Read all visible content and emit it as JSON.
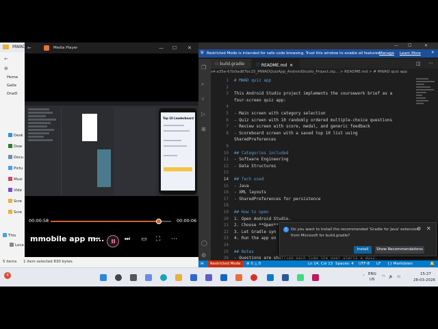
{
  "explorer": {
    "title": "MWAD",
    "nav_items": [
      "Home",
      "Galle",
      "OneD"
    ],
    "side_items": [
      "Desk",
      "Dow",
      "Docu",
      "Pictu",
      "Musi",
      "Vide",
      "Scre",
      "Scre"
    ],
    "this_pc": "This",
    "local": "Loca",
    "status_items": "5 items",
    "status_selected": "1 item selected  830 bytes"
  },
  "player": {
    "title": "Media Player",
    "elapsed": "00:00:58",
    "remaining": "00:00:06",
    "progress": 0.9,
    "name": "mmobile app m...",
    "colors": {
      "accent": "#d06432"
    }
  },
  "phone": {
    "title": "Top 10 Leaderboard"
  },
  "vscode": {
    "restricted_text": "Restricted Mode is intended for safe code browsing. Trust this window to enable all features.",
    "manage": "Manage",
    "learn_more": "Learn More",
    "tabs": [
      "build.gradle",
      "README.md"
    ],
    "breadcrumb": "s4-a35e-67b0ad87bc15_MWADQuizApp_AndroidStudio_Project.zip... > README.md > # MWAD quiz app",
    "lines": [
      {
        "n": "1",
        "t": "# MWAD quiz app",
        "c": "h"
      },
      {
        "n": "2",
        "t": "",
        "c": "k"
      },
      {
        "n": "3",
        "t": "This Android Studio project implements the coursework brief as a",
        "c": "k"
      },
      {
        "n": "",
        "t": "four-screen quiz app:",
        "c": "k"
      },
      {
        "n": "4",
        "t": "",
        "c": "k"
      },
      {
        "n": "5",
        "t": "- Main screen with category selection",
        "c": "k"
      },
      {
        "n": "6",
        "t": "- Quiz screen with 10 randomly ordered multiple-choice questions",
        "c": "k"
      },
      {
        "n": "7",
        "t": "- Review screen with score, medal, and generic feedback",
        "c": "k"
      },
      {
        "n": "8",
        "t": "- Scoreboard screen with a saved top 10 list using",
        "c": "k"
      },
      {
        "n": "",
        "t": "SharedPreferences",
        "c": "k"
      },
      {
        "n": "9",
        "t": "",
        "c": "k"
      },
      {
        "n": "10",
        "t": "## Categories included",
        "c": "h"
      },
      {
        "n": "11",
        "t": "- Software Engineering",
        "c": "k"
      },
      {
        "n": "12",
        "t": "- Data Structures",
        "c": "k"
      },
      {
        "n": "13",
        "t": "",
        "c": "k"
      },
      {
        "n": "14",
        "t": "## Tech used",
        "c": "h"
      },
      {
        "n": "15",
        "t": "- Java",
        "c": "k"
      },
      {
        "n": "16",
        "t": "- XML layouts",
        "c": "k"
      },
      {
        "n": "17",
        "t": "- SharedPreferences for persistence",
        "c": "k"
      },
      {
        "n": "18",
        "t": "",
        "c": "k"
      },
      {
        "n": "19",
        "t": "## How to open",
        "c": "h"
      },
      {
        "n": "20",
        "t": "1. Open Android Studio.",
        "c": "k"
      },
      {
        "n": "21",
        "t": "2. Choose **Open**",
        "c": "k"
      },
      {
        "n": "22",
        "t": "3. Let Gradle syn",
        "c": "k"
      },
      {
        "n": "23",
        "t": "4. Run the app on",
        "c": "k"
      },
      {
        "n": "24",
        "t": "",
        "c": "k"
      },
      {
        "n": "25",
        "t": "## Notes",
        "c": "h"
      },
      {
        "n": "26",
        "t": "- Questions are shuffled each time the user starts a quiz.",
        "c": "k"
      }
    ],
    "notification": {
      "message": "Do you want to install the recommended 'Gradle for Java' extension from Microsoft for build.gradle?",
      "install": "Install",
      "show": "Show Recommendations"
    },
    "status": {
      "restricted": "Restricted Mode",
      "errors": "⊗ 0 △ 0",
      "position": "Ln 14, Col 13",
      "spaces": "Spaces: 4",
      "encoding": "UTF-8",
      "eol": "LF",
      "lang": "{} Markdown"
    }
  },
  "taskbar": {
    "lang": "ENG",
    "region": "US",
    "time": "15:27",
    "date": "28-03-2026",
    "badge": "4"
  }
}
